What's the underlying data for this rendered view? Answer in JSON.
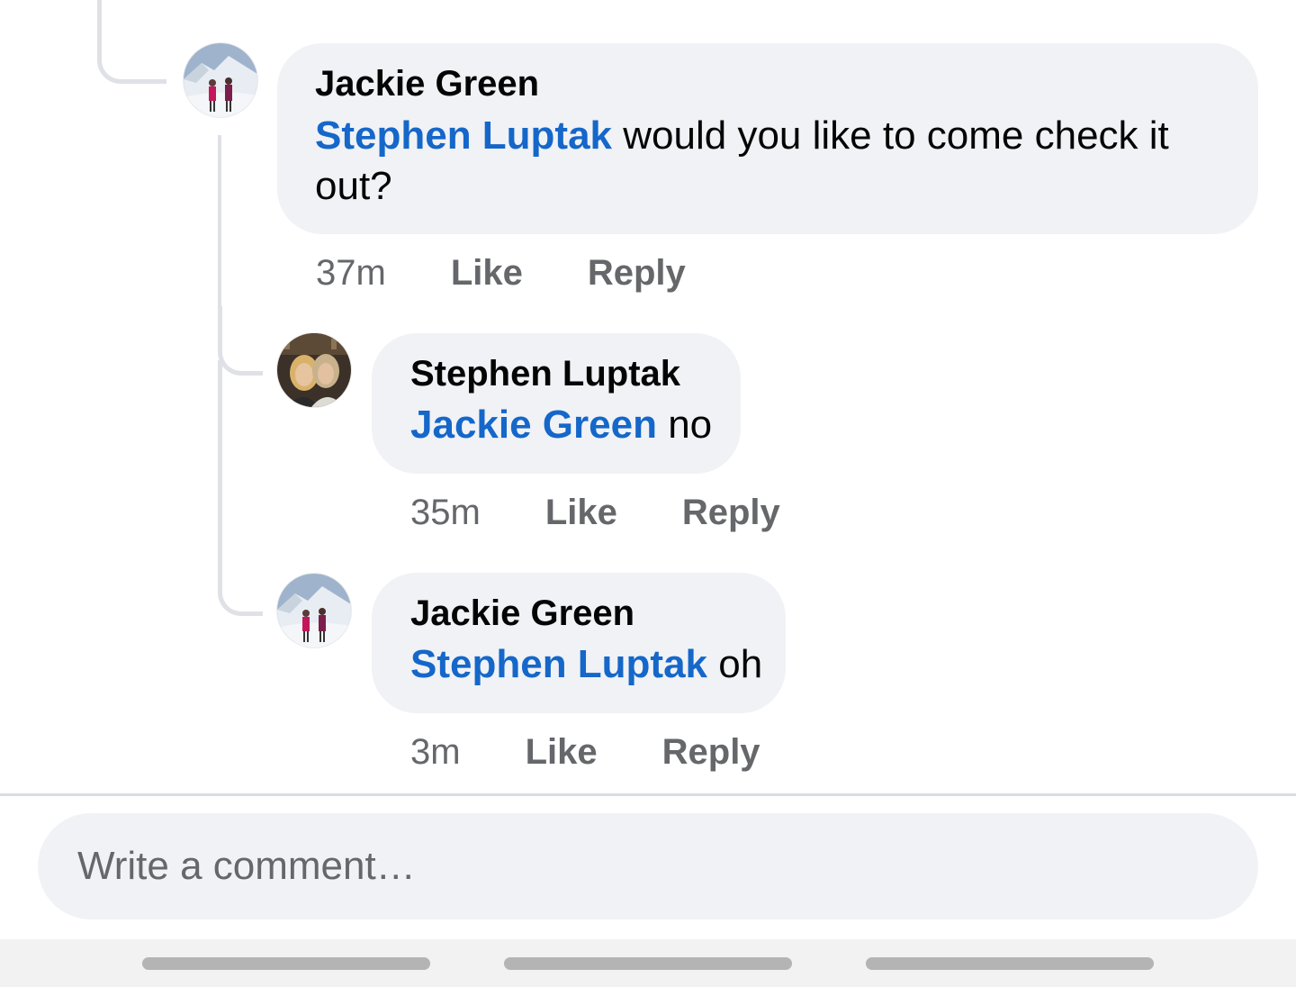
{
  "comments": [
    {
      "author": "Jackie Green",
      "mention": "Stephen Luptak",
      "text": " would you like to come check it out?",
      "time": "37m",
      "like_label": "Like",
      "reply_label": "Reply",
      "avatar_icon": "profile-photo-snow-mountain"
    },
    {
      "author": "Stephen Luptak",
      "mention": "Jackie Green",
      "text": " no",
      "time": "35m",
      "like_label": "Like",
      "reply_label": "Reply",
      "avatar_icon": "profile-photo-two-people"
    },
    {
      "author": "Jackie Green",
      "mention": "Stephen Luptak",
      "text": " oh",
      "time": "3m",
      "like_label": "Like",
      "reply_label": "Reply",
      "avatar_icon": "profile-photo-snow-mountain"
    }
  ],
  "composer": {
    "placeholder": "Write a comment…"
  },
  "colors": {
    "mention": "#1567c9",
    "bubble": "#f0f2f5",
    "meta_text": "#65676b",
    "thread_line": "#dfe1e6"
  }
}
